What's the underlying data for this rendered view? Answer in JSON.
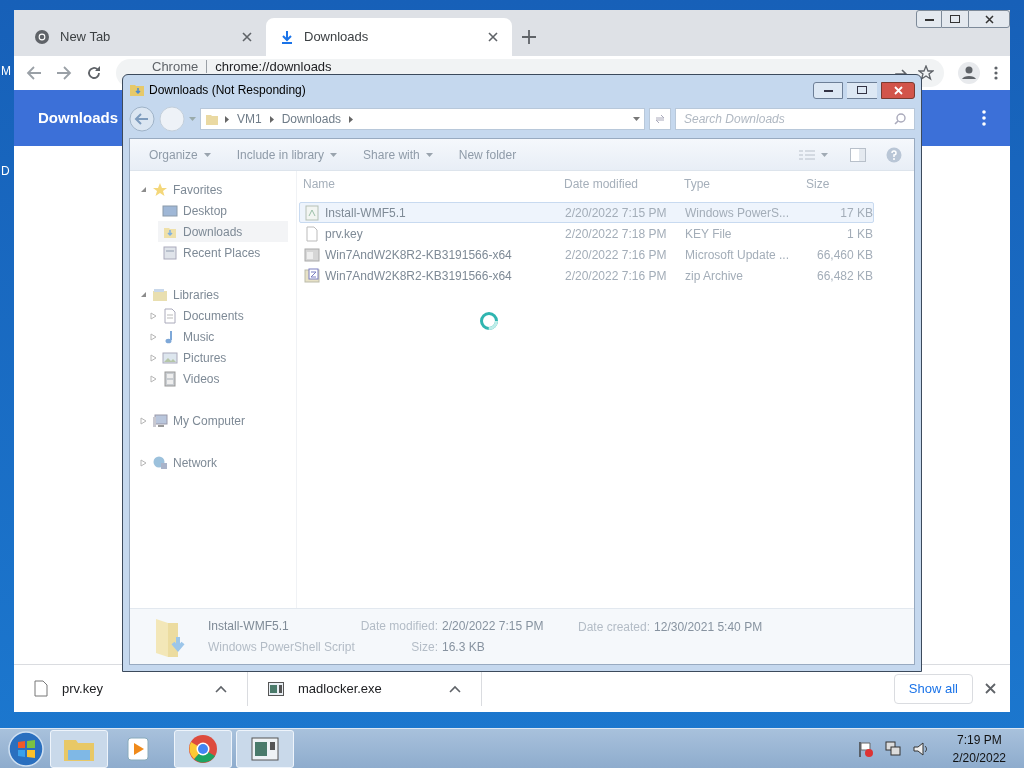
{
  "desktop": {
    "icon_labels": [
      "M",
      "D"
    ]
  },
  "chrome": {
    "tabs": [
      {
        "title": "New Tab",
        "kind": "chrome",
        "selected": false
      },
      {
        "title": "Downloads",
        "kind": "download",
        "selected": true
      }
    ],
    "address": {
      "site_label": "Chrome",
      "url": "chrome://downloads"
    },
    "header": {
      "title": "Downloads"
    },
    "download_shelf": {
      "items": [
        {
          "name": "prv.key",
          "kind": "file"
        },
        {
          "name": "madlocker.exe",
          "kind": "app"
        }
      ],
      "show_all": "Show all"
    }
  },
  "explorer": {
    "title": "Downloads (Not Responding)",
    "breadcrumb": [
      "VM1",
      "Downloads"
    ],
    "search": {
      "placeholder": "Search Downloads"
    },
    "toolbar": [
      {
        "label": "Organize",
        "dropdown": true
      },
      {
        "label": "Include in library",
        "dropdown": true
      },
      {
        "label": "Share with",
        "dropdown": true
      },
      {
        "label": "New folder",
        "dropdown": false
      }
    ],
    "nav": [
      {
        "label": "Favorites",
        "kind": "star",
        "selected": false,
        "expanded": true,
        "children": [
          {
            "label": "Desktop",
            "kind": "desktop",
            "selected": false
          },
          {
            "label": "Downloads",
            "kind": "downloads",
            "selected": true
          },
          {
            "label": "Recent Places",
            "kind": "recent",
            "selected": false
          }
        ]
      },
      {
        "label": "Libraries",
        "kind": "library",
        "selected": false,
        "expanded": true,
        "children": [
          {
            "label": "Documents",
            "kind": "documents",
            "selected": false,
            "expanded": false
          },
          {
            "label": "Music",
            "kind": "music",
            "selected": false,
            "expanded": false
          },
          {
            "label": "Pictures",
            "kind": "pictures",
            "selected": false,
            "expanded": false
          },
          {
            "label": "Videos",
            "kind": "videos",
            "selected": false,
            "expanded": false
          }
        ]
      },
      {
        "label": "My Computer",
        "kind": "computer",
        "selected": false,
        "expanded": false
      },
      {
        "label": "Network",
        "kind": "network",
        "selected": false,
        "expanded": false
      }
    ],
    "columns": [
      "Name",
      "Date modified",
      "Type",
      "Size"
    ],
    "rows": [
      {
        "name": "Install-WMF5.1",
        "kind": "script",
        "date": "2/20/2022 7:15 PM",
        "type": "Windows PowerS...",
        "size": "17 KB",
        "selected": true
      },
      {
        "name": "prv.key",
        "kind": "blank",
        "date": "2/20/2022 7:18 PM",
        "type": "KEY File",
        "size": "1 KB",
        "selected": false
      },
      {
        "name": "Win7AndW2K8R2-KB3191566-x64",
        "kind": "update",
        "date": "2/20/2022 7:16 PM",
        "type": "Microsoft Update ...",
        "size": "66,460 KB",
        "selected": false
      },
      {
        "name": "Win7AndW2K8R2-KB3191566-x64",
        "kind": "zip",
        "date": "2/20/2022 7:16 PM",
        "type": "zip Archive",
        "size": "66,482 KB",
        "selected": false
      }
    ],
    "details": {
      "name": "Install-WMF5.1",
      "type": "Windows PowerShell Script",
      "fields": [
        {
          "label": "Date modified:",
          "value": "2/20/2022 7:15 PM"
        },
        {
          "label": "Size:",
          "value": "16.3 KB"
        },
        {
          "label": "Date created:",
          "value": "12/30/2021 5:40 PM"
        }
      ]
    }
  },
  "taskbar": {
    "buttons": [
      {
        "kind": "explorer",
        "selected": true
      },
      {
        "kind": "media",
        "selected": false
      },
      {
        "kind": "chrome",
        "selected": true
      },
      {
        "kind": "window",
        "selected": true
      }
    ],
    "clock": {
      "time": "7:19 PM",
      "date": "2/20/2022"
    }
  }
}
